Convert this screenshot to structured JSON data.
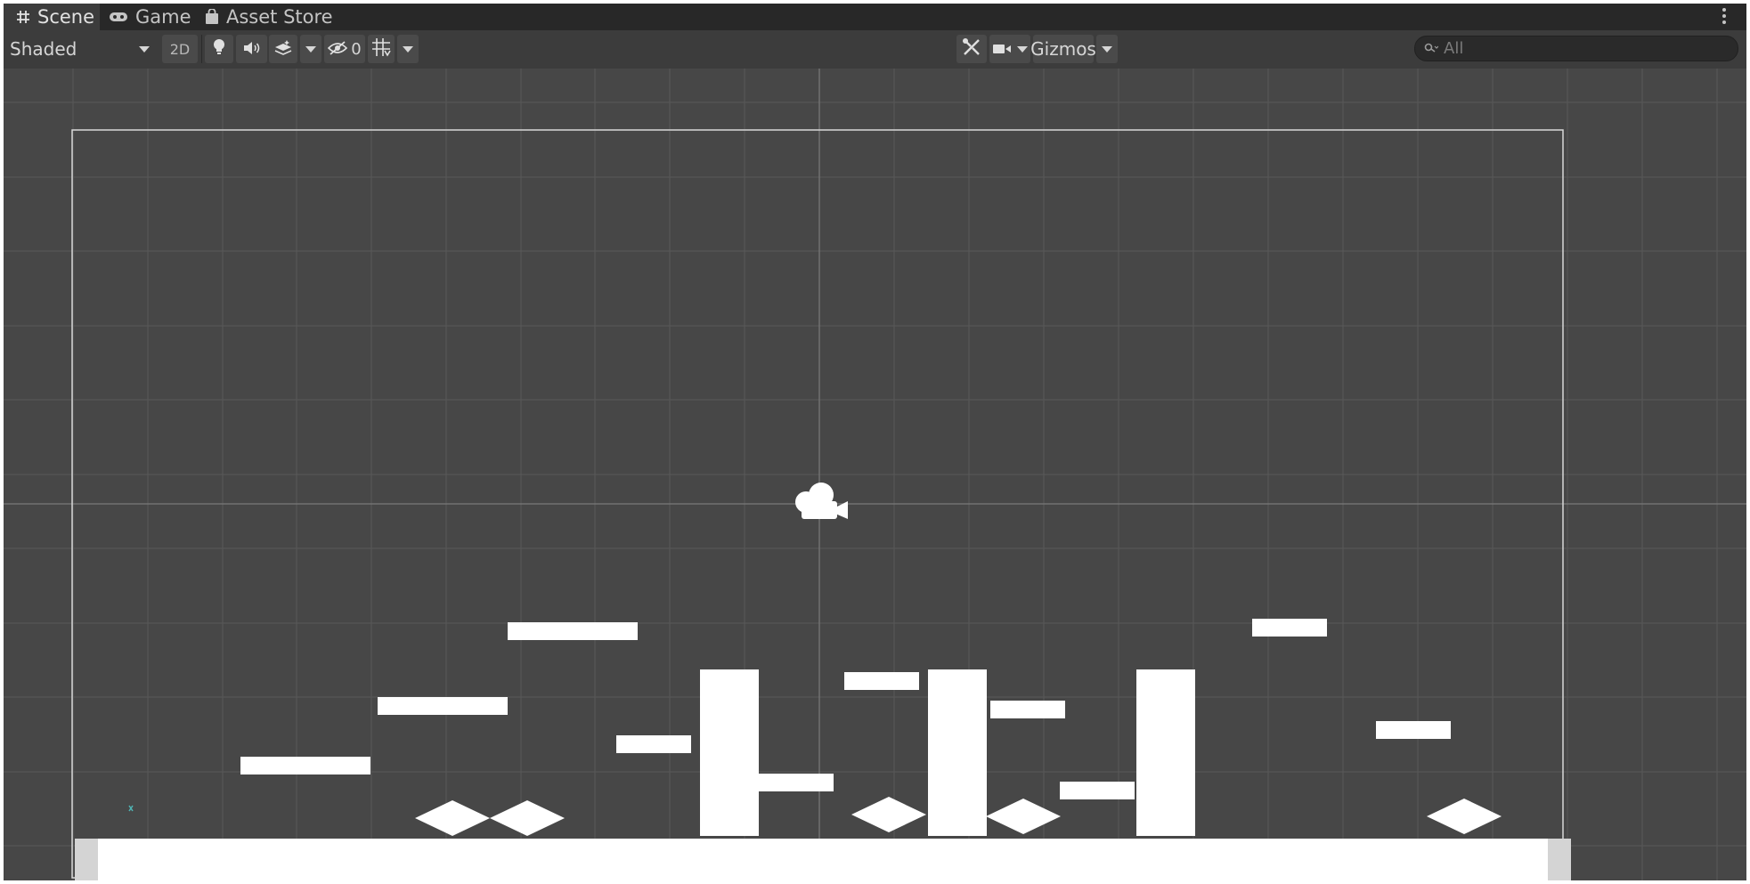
{
  "tabs": [
    {
      "label": "Scene",
      "icon": "grid-hash-icon",
      "active": true
    },
    {
      "label": "Game",
      "icon": "gamepad-icon",
      "active": false
    },
    {
      "label": "Asset Store",
      "icon": "shopping-bag-icon",
      "active": false
    }
  ],
  "toolbar": {
    "shading_mode": "Shaded",
    "mode_2d_label": "2D",
    "hidden_count": "0",
    "gizmos_label": "Gizmos",
    "search_placeholder": "All"
  },
  "scene": {
    "objects": [
      "camera-gizmo",
      "ground-platform",
      "floating-platforms",
      "pillars",
      "diamond-spikes"
    ]
  },
  "colors": {
    "tab_bar": "#282828",
    "active_tab": "#3c3c3c",
    "toolbar": "#3c3c3c",
    "viewport_bg": "#474747",
    "grid_line": "#5a5a5a",
    "sprite": "#ffffff"
  }
}
